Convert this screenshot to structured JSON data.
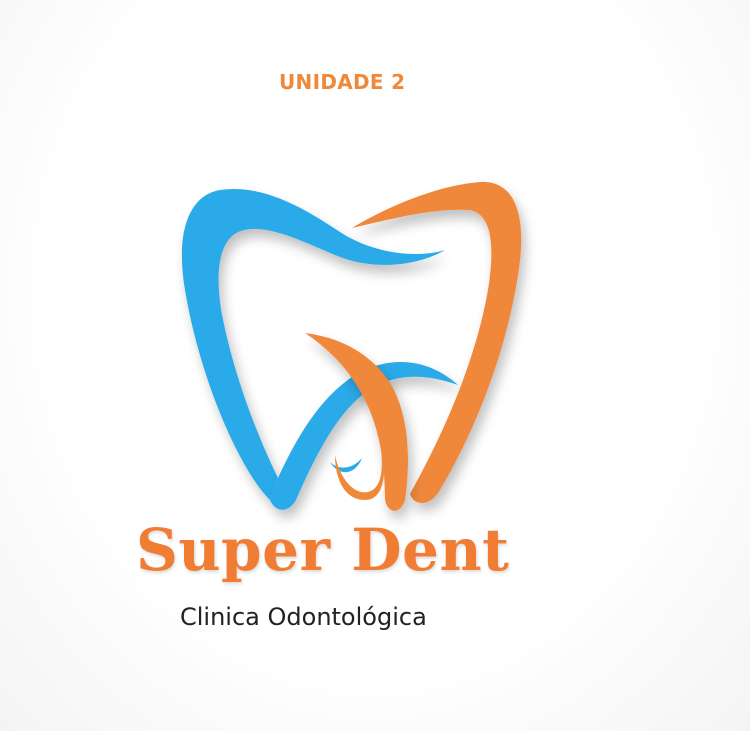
{
  "header": {
    "unit_label": "UNIDADE 2"
  },
  "logo": {
    "icon": "tooth-icon",
    "colors": {
      "blue": "#2aaae9",
      "orange": "#f0883a"
    }
  },
  "brand": {
    "name": "Super Dent",
    "tagline": "Clinica Odontológica",
    "name_color": "#f07d33",
    "tagline_color": "#222222"
  }
}
